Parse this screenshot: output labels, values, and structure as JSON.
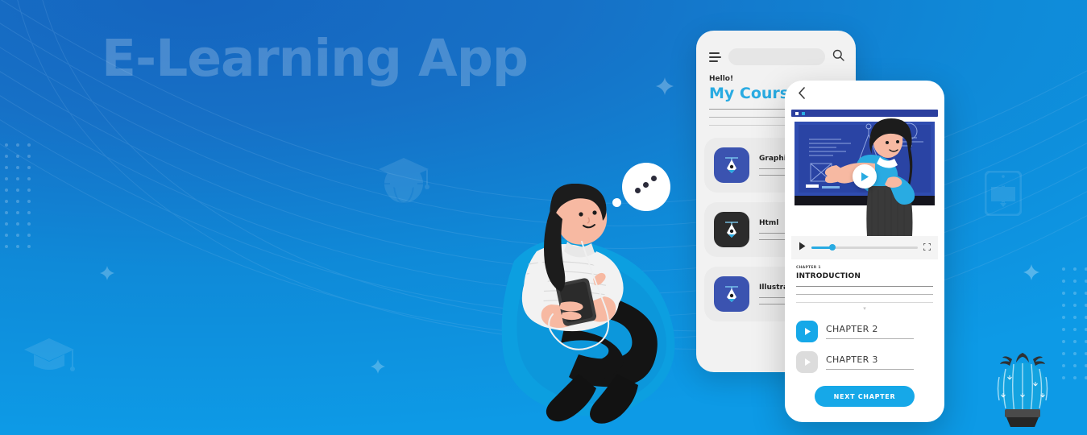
{
  "hero": {
    "headline": "E-Learning App",
    "background_top_color": "#1565bf",
    "background_bottom_color": "#0d9ae6",
    "headline_color": "rgba(255,255,255,0.22)"
  },
  "decorations": {
    "globe_cap_icon": "globe-graduation-cap-icon",
    "graduation_cap_icon": "graduation-cap-icon",
    "tablet_book_icon": "tablet-book-icon",
    "cactus": "cactus-plant",
    "sparkles": [
      "sparkle-star",
      "sparkle-star",
      "sparkle-star"
    ],
    "thought_bubble": "thought-bubble"
  },
  "illustration": {
    "person": "person-sitting-with-phone",
    "blob_color": "#0d9ae6"
  },
  "phone_back": {
    "menu_icon": "hamburger-menu-icon",
    "search_icon": "search-icon",
    "search_placeholder": "",
    "search_value": "",
    "greeting": "Hello!",
    "title": "My Courses",
    "title_color": "#29ABE2",
    "courses": [
      {
        "name": "Graphic Design",
        "icon": "pen-nib-icon",
        "icon_style": "blue"
      },
      {
        "name": "Html",
        "icon": "pen-nib-icon",
        "icon_style": "dark"
      },
      {
        "name": "Illustrator",
        "icon": "pen-nib-icon",
        "icon_style": "blue"
      }
    ]
  },
  "phone_front": {
    "back_icon": "chevron-left-icon",
    "browser_dots": [
      "white",
      "cyan"
    ],
    "video": {
      "thumbnail": "teacher-at-whiteboard-illustration",
      "play_overlay_icon": "play-icon",
      "play_button_icon": "play-icon",
      "fullscreen_icon": "fullscreen-icon",
      "progress_percent": 20,
      "progress_color": "#29ABE2"
    },
    "current_chapter": {
      "kicker": "CHAPTER 1",
      "title": "INTRODUCTION",
      "expand_icon": "chevron-down-icon"
    },
    "chapters": [
      {
        "label": "CHAPTER 2",
        "state": "active",
        "icon": "play-icon"
      },
      {
        "label": "CHAPTER 3",
        "state": "idle",
        "icon": "play-icon"
      }
    ],
    "next_button_label": "NEXT CHAPTER",
    "accent_color": "#16A8E8"
  }
}
